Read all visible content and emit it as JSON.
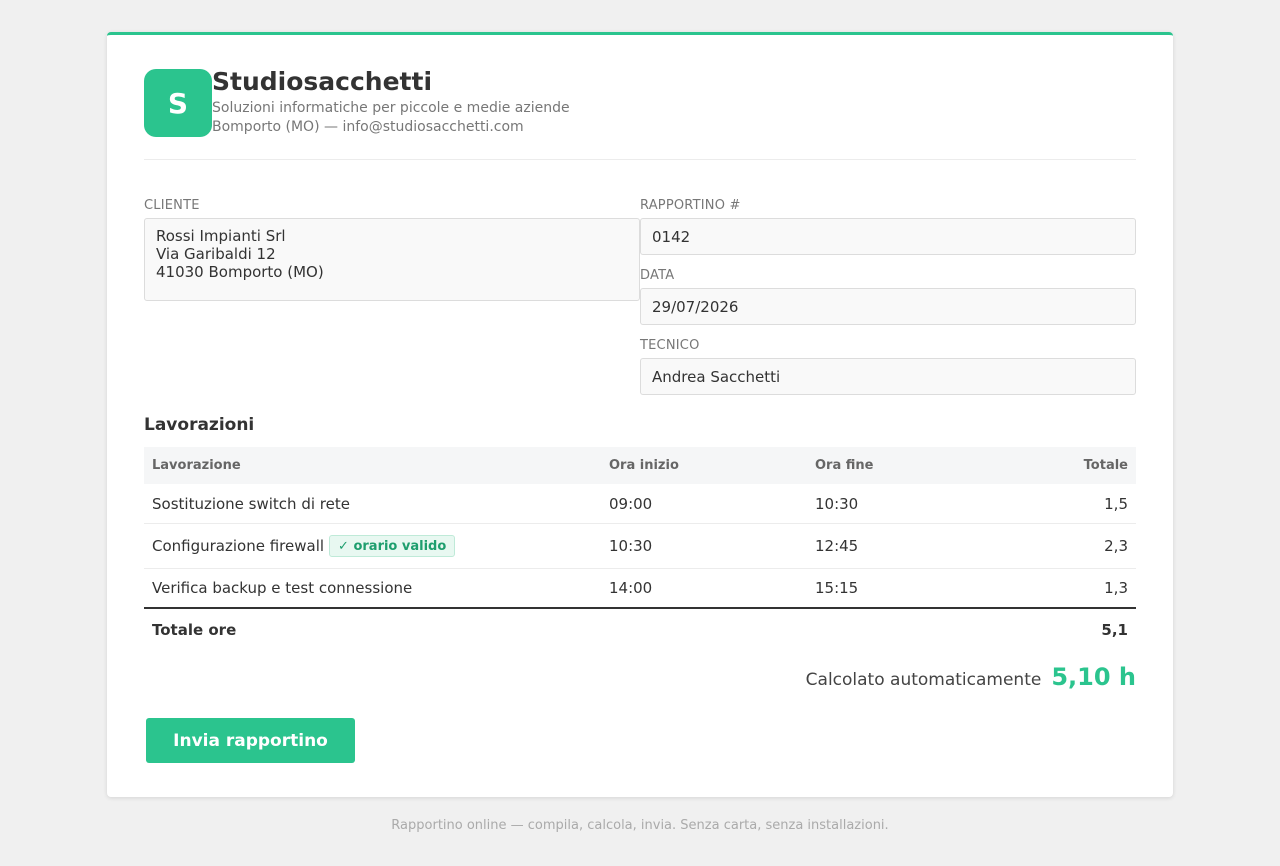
{
  "brand": {
    "logo_letter": "S",
    "name": "Studiosacchetti",
    "tagline": "Soluzioni informatiche per piccole e medie aziende",
    "contact": "Bomporto (MO) — info@studiosacchetti.com"
  },
  "form": {
    "cliente_label": "CLIENTE",
    "cliente_lines": [
      "Rossi Impianti Srl",
      "Via Garibaldi 12",
      "41030 Bomporto (MO)"
    ],
    "rapportino_label": "RAPPORTINO #",
    "rapportino_value": "0142",
    "data_label": "DATA",
    "data_value": "29/07/2026",
    "tecnico_label": "TECNICO",
    "tecnico_value": "Andrea Sacchetti"
  },
  "lavorazioni": {
    "title": "Lavorazioni",
    "headers": [
      "Lavorazione",
      "Ora inizio",
      "Ora fine",
      "Totale"
    ],
    "rows": [
      {
        "name": "Sostituzione switch di rete",
        "start": "09:00",
        "end": "10:30",
        "total": "1,5"
      },
      {
        "name": "Configurazione firewall",
        "badge": "✓ orario valido",
        "start": "10:30",
        "end": "12:45",
        "total": "2,3"
      },
      {
        "name": "Verifica backup e test connessione",
        "start": "14:00",
        "end": "15:15",
        "total": "1,3"
      }
    ],
    "total_label": "Totale ore",
    "total_value": "5,1"
  },
  "calc": {
    "label": "Calcolato automaticamente",
    "value": "5,10 h"
  },
  "submit_label": "Invia rapportino",
  "footer": "Rapportino online — compila, calcola, invia. Senza carta, senza installazioni.",
  "colors": {
    "accent": "#2bc48e",
    "background": "#f0f0f0"
  }
}
